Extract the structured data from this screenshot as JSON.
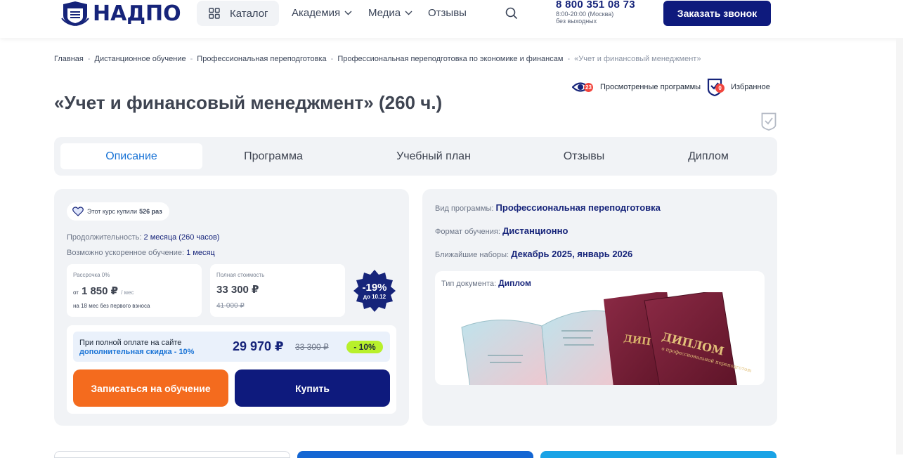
{
  "header": {
    "logo_text": "НАДПО",
    "catalog_label": "Каталог",
    "nav": [
      {
        "label": "Академия"
      },
      {
        "label": "Медиа"
      },
      {
        "label": "Отзывы"
      }
    ],
    "phone": "8 800 351 08 73",
    "hours": "8:00-20:00 (Москва)",
    "days": "без выходных",
    "order_call_label": "Заказать звонок"
  },
  "breadcrumb": [
    "Главная",
    "Дистанционное обучение",
    "Профессиональная переподготовка",
    "Профессиональная переподготовка по экономике и финансам",
    "«Учет и финансовый менеджмент»"
  ],
  "fav": {
    "viewed_label": "Просмотренные программы",
    "viewed_count": "23",
    "favorites_label": "Избранное",
    "favorites_count": "0"
  },
  "page_title": "«Учет и финансовый менеджмент» (260 ч.)",
  "tabs": [
    "Описание",
    "Программа",
    "Учебный план",
    "Отзывы",
    "Диплом"
  ],
  "course": {
    "bought_prefix": "Этот курс купили",
    "bought_count": "526 раз",
    "duration_label": "Продолжительность:",
    "duration_value": "2 месяца (260 часов)",
    "accelerated_label": "Возможно ускоренное обучение:",
    "accelerated_value": "1 месяц",
    "installment": {
      "label": "Рассрочка 0%",
      "from": "от",
      "amount": "1 850 ₽",
      "per": "/ мес",
      "note": "на 18 мес без первого взноса"
    },
    "full_cost": {
      "label": "Полная стоимость",
      "price": "33 300 ₽",
      "old_price": "41 000 ₽"
    },
    "discount": {
      "percent": "-19%",
      "until": "до 10.12"
    },
    "full_payment": {
      "line1": "При полной оплате на сайте",
      "line2": "дополнительная скидка - 10%",
      "price": "29 970 ₽",
      "old_price": "33 300 ₽",
      "tag": "- 10%"
    },
    "enroll_label": "Записаться на обучение",
    "buy_label": "Купить"
  },
  "program_info": {
    "type_label": "Вид программы:",
    "type_value": "Профессиональная переподготовка",
    "format_label": "Формат обучения:",
    "format_value": "Дистанционно",
    "enrollment_label": "Ближайшие наборы:",
    "enrollment_value": "Декабрь 2025, январь 2026",
    "doc_label": "Тип документа:",
    "doc_value": "Диплом",
    "diploma_cover_text": "ДИПЛОМ",
    "diploma_cover_sub": "о профессиональной переподготовке"
  },
  "colors": {
    "brand_navy": "#0e1a7d",
    "accent_orange": "#f46b1e",
    "link_blue": "#1a74d6",
    "lime_tag": "#b8f02c",
    "badge_red": "#f2453d"
  }
}
